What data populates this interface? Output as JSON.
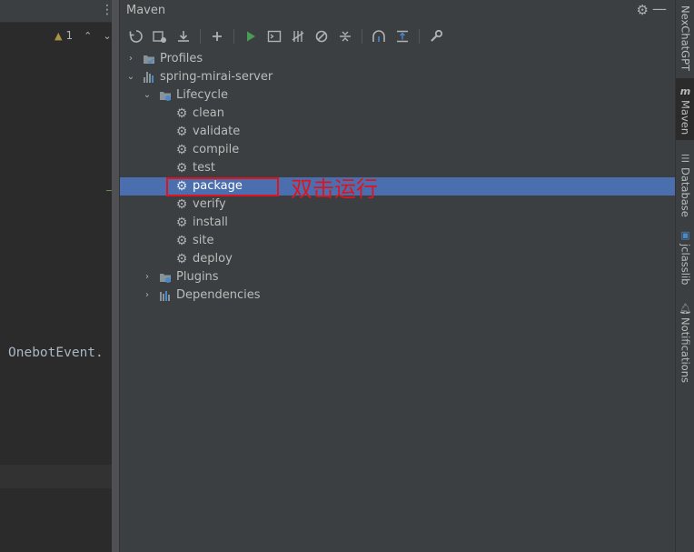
{
  "editor": {
    "warning_count": "1",
    "code_text": "OnebotEvent."
  },
  "maven": {
    "title": "Maven",
    "toolbar": [
      {
        "name": "reload-all-icon"
      },
      {
        "name": "generate-sources-icon"
      },
      {
        "name": "download-sources-icon"
      },
      {
        "name": "add-maven-project-icon"
      },
      {
        "name": "run-maven-build-icon"
      },
      {
        "name": "execute-maven-goal-icon"
      },
      {
        "name": "toggle-offline-mode-icon"
      },
      {
        "name": "skip-tests-icon"
      },
      {
        "name": "collapse-all-icon"
      },
      {
        "name": "show-dependencies-icon"
      },
      {
        "name": "expand-all-icon"
      },
      {
        "name": "build-tools-settings-icon"
      }
    ],
    "tree": {
      "profiles": "Profiles",
      "project": "spring-mirai-server",
      "lifecycle": "Lifecycle",
      "goals": [
        "clean",
        "validate",
        "compile",
        "test",
        "package",
        "verify",
        "install",
        "site",
        "deploy"
      ],
      "selected_goal": "package",
      "plugins": "Plugins",
      "dependencies": "Dependencies"
    },
    "annotation": "双击运行"
  },
  "stripe": {
    "items": [
      "NexChatGPT",
      "Maven",
      "Database",
      "jclasslib",
      "Notifications"
    ]
  },
  "colors": {
    "selection": "#4b6eaf",
    "annotation": "#e0141e",
    "run_green": "#499c54"
  }
}
